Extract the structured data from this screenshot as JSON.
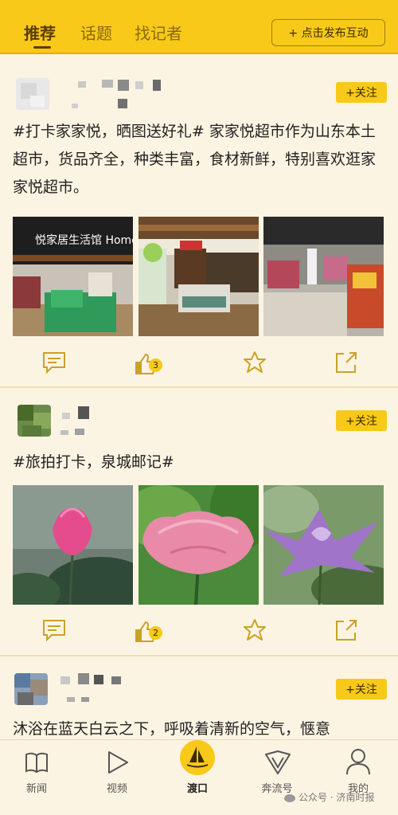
{
  "header": {
    "tabs": [
      {
        "label": "推荐"
      },
      {
        "label": "话题"
      },
      {
        "label": "找记者"
      }
    ],
    "publish_label": "+ 点击发布互动"
  },
  "posts": [
    {
      "follow_label": "+关注",
      "text": "#打卡家家悦，晒图送好礼# 家家悦超市作为山东本土超市，货品齐全，种类丰富，食材新鲜，特别喜欢逛家家悦超市。",
      "photo_sign": "悦家居生活馆 Home",
      "likes": "3"
    },
    {
      "follow_label": "+关注",
      "text": "#旅拍打卡，泉城邮记#",
      "likes": "2"
    },
    {
      "follow_label": "+关注",
      "text": "沐浴在蓝天白云之下，呼吸着清新的空气，惬意"
    }
  ],
  "bottom_nav": [
    {
      "label": "新闻",
      "icon": "book-icon"
    },
    {
      "label": "视频",
      "icon": "play-icon"
    },
    {
      "label": "渡口",
      "icon": "sailboat-icon"
    },
    {
      "label": "奔流号",
      "icon": "v-shield-icon"
    },
    {
      "label": "我的",
      "icon": "user-icon"
    }
  ],
  "watermark": "公众号 · 济南时报",
  "colors": {
    "accent": "#f8c919",
    "background": "#fcf4e2"
  }
}
